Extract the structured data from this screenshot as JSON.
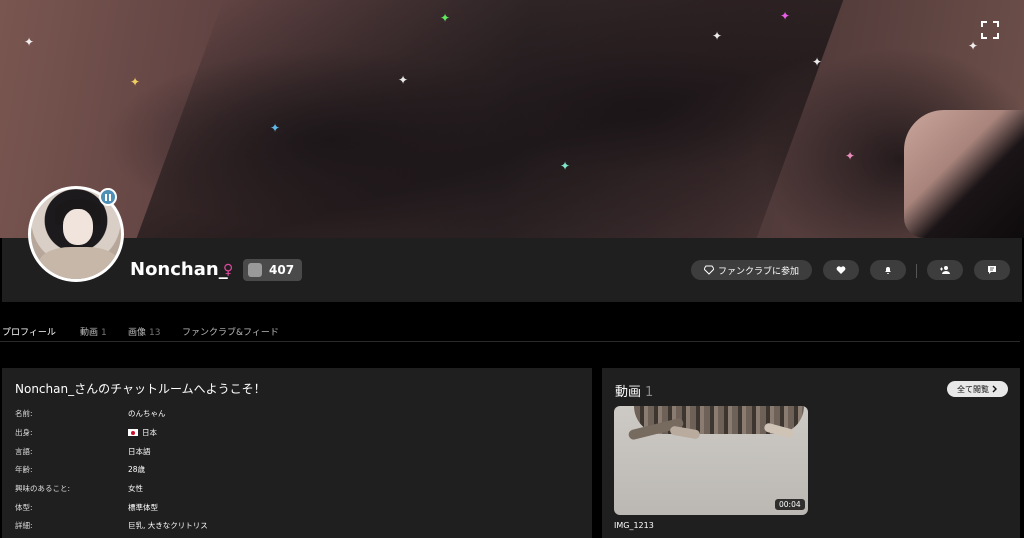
{
  "profile": {
    "username": "Nonchan_",
    "gender_symbol": "♀",
    "rank_value": "407"
  },
  "actions": {
    "fanclub_label": "ファンクラブに参加"
  },
  "tabs": [
    {
      "label": "プロフィール",
      "count": ""
    },
    {
      "label": "動画",
      "count": "1"
    },
    {
      "label": "画像",
      "count": "13"
    },
    {
      "label": "ファンクラブ&フィード",
      "count": ""
    }
  ],
  "about": {
    "welcome": "Nonchan_さんのチャットルームへようこそ！",
    "rows": [
      {
        "label": "名前:",
        "value": "のんちゃん"
      },
      {
        "label": "出身:",
        "value": "日本"
      },
      {
        "label": "言語:",
        "value": "日本語"
      },
      {
        "label": "年齢:",
        "value": "28歳"
      },
      {
        "label": "興味のあること:",
        "value": "女性"
      },
      {
        "label": "体型:",
        "value": "標準体型"
      },
      {
        "label": "詳細:",
        "value": "巨乳, 大きなクリトリス"
      }
    ]
  },
  "videos": {
    "title": "動画",
    "count": "1",
    "view_all_label": "全て閲覧",
    "items": [
      {
        "duration": "00:04",
        "title": "IMG_1213"
      }
    ]
  },
  "icons": {
    "fullscreen": "fullscreen-icon",
    "heart": "heart-icon",
    "bell": "bell-icon",
    "follow": "add-user-icon",
    "message": "message-icon",
    "diamond": "diamond-icon"
  },
  "colors": {
    "gender": "#e0479e",
    "status_badge": "#4d8fb5",
    "panel": "#1f1f1f"
  }
}
